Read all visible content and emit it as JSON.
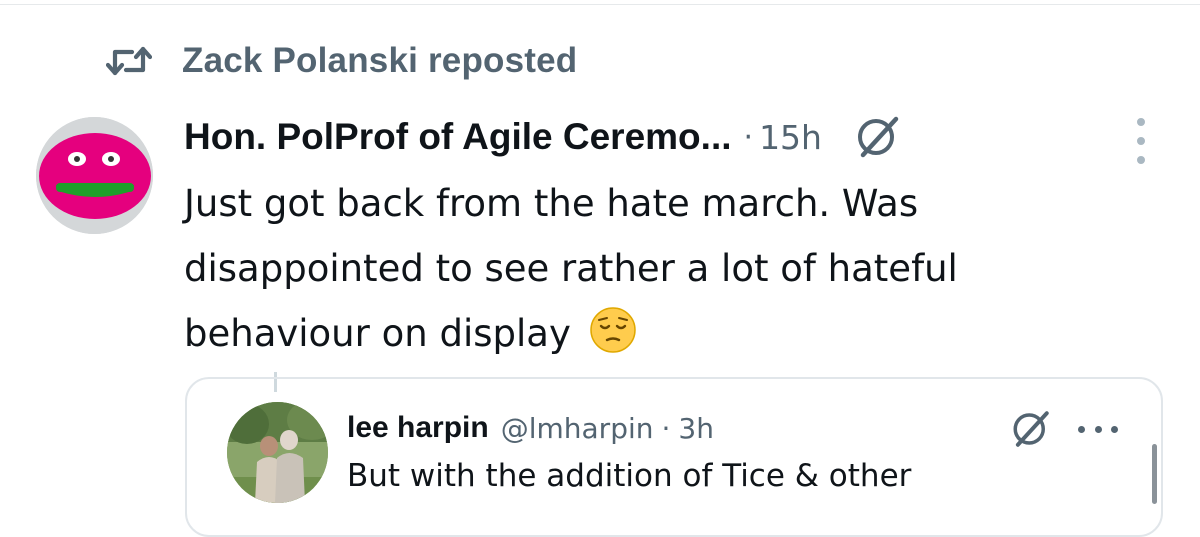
{
  "repost": {
    "icon": "repost-icon",
    "text": "Zack Polanski reposted"
  },
  "post": {
    "avatar_icon": "smiling-face-avatar",
    "display_name": "Hon. PolProf of Agile Ceremo...",
    "separator": "·",
    "timestamp": "15h",
    "grok_icon": "grok-icon",
    "more_icon": "more-vertical-icon",
    "body_lines": [
      "Just got back from the hate march. Was",
      "disappointed to see rather a lot of hateful",
      "behaviour on display"
    ],
    "emoji": "pensive-face-emoji"
  },
  "quote": {
    "avatar_icon": "photo-avatar",
    "display_name": "lee harpin",
    "handle": "@lmharpin",
    "separator": "·",
    "timestamp": "3h",
    "grok_icon": "grok-icon",
    "more_icon": "more-horizontal-icon",
    "body": "But with the addition of Tice & other"
  },
  "colors": {
    "text_primary": "#0f1419",
    "text_secondary": "#536471",
    "border": "#e1e6ea",
    "avatar_pink": "#e5007e",
    "avatar_green": "#1f9f2a"
  }
}
